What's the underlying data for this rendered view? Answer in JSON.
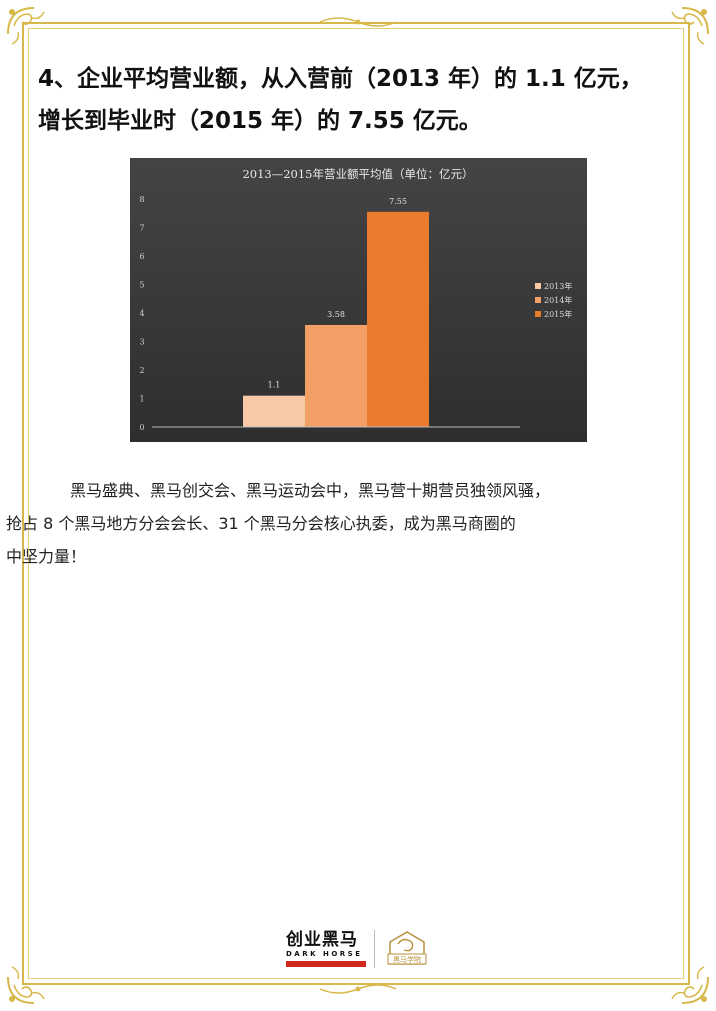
{
  "headline": {
    "line1": "4、企业平均营业额，从入营前（2013 年）的 1.1 亿元，",
    "line2": "增长到毕业时（2015 年）的 7.55 亿元。"
  },
  "paragraph": {
    "line1": "黑马盛典、黑马创交会、黑马运动会中，黑马营十期营员独领风骚，",
    "line2": "抢占 8 个黑马地方分会会长、31 个黑马分会核心执委，成为黑马商圈的",
    "line3": "中坚力量！"
  },
  "footer": {
    "logo_cn": "创业黑马",
    "logo_en": "DARK HORSE",
    "logo_right_text": "黑马学院"
  },
  "colors": {
    "frame_gold": "#d8b84a",
    "chart_bg": "#3a3a3a",
    "bar_2013": "#f7c9a6",
    "bar_2014": "#f2a066",
    "bar_2015": "#ea7a2c",
    "brand_red": "#d0281e"
  },
  "chart_data": {
    "type": "bar",
    "title": "2013—2015年营业额平均值（单位：亿元）",
    "categories": [
      "2013年",
      "2014年",
      "2015年"
    ],
    "series": [
      {
        "name": "2013年",
        "values": [
          1.1
        ]
      },
      {
        "name": "2014年",
        "values": [
          3.58
        ]
      },
      {
        "name": "2015年",
        "values": [
          7.55
        ]
      }
    ],
    "data_labels": [
      "1.1",
      "3.58",
      "7.55"
    ],
    "ylim": [
      0,
      8
    ],
    "y_ticks": [
      "0",
      "1",
      "2",
      "3",
      "4",
      "5",
      "6",
      "7",
      "8"
    ],
    "grid": false,
    "legend": "right"
  }
}
